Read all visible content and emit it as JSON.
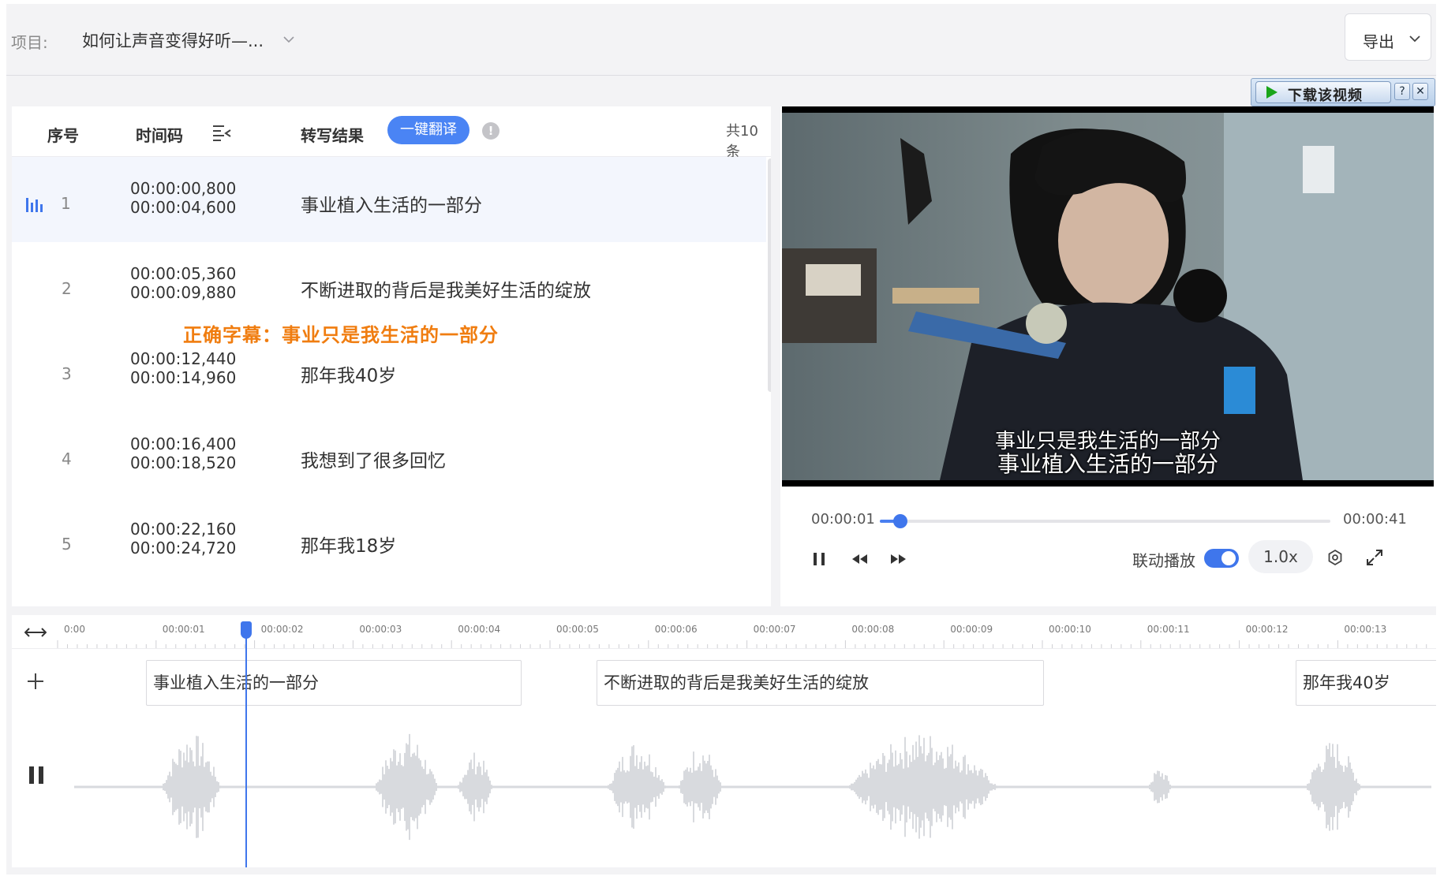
{
  "header": {
    "project_label": "项目:",
    "project_name": "如何让声音变得好听—...",
    "export_label": "导出"
  },
  "download_bar": {
    "label": "下载该视频",
    "help": "?",
    "close": "✕"
  },
  "list": {
    "columns": {
      "index": "序号",
      "timecode": "时间码",
      "result": "转写结果"
    },
    "translate_button": "一键翻译",
    "info": "!",
    "count": "共10条",
    "rows": [
      {
        "index": "1",
        "start": "00:00:00,800",
        "end": "00:00:04,600",
        "text": "事业植入生活的一部分"
      },
      {
        "index": "2",
        "start": "00:00:05,360",
        "end": "00:00:09,880",
        "text": "不断进取的背后是我美好生活的绽放"
      },
      {
        "index": "3",
        "start": "00:00:12,440",
        "end": "00:00:14,960",
        "text": "那年我40岁"
      },
      {
        "index": "4",
        "start": "00:00:16,400",
        "end": "00:00:18,520",
        "text": "我想到了很多回忆"
      },
      {
        "index": "5",
        "start": "00:00:22,160",
        "end": "00:00:24,720",
        "text": "那年我18岁"
      }
    ],
    "correct_note": "正确字幕：事业只是我生活的一部分"
  },
  "player": {
    "subtitle_overlay": "事业只是我生活的一部分",
    "subtitle_main": "事业植入生活的一部分",
    "current_time": "00:00:01",
    "total_time": "00:00:41",
    "progress": 0.045,
    "link_play_label": "联动播放",
    "link_play_on": true,
    "speed": "1.0x"
  },
  "timeline": {
    "ticks": [
      "0:00",
      "00:00:01",
      "00:00:02",
      "00:00:03",
      "00:00:04",
      "00:00:05",
      "00:00:06",
      "00:00:07",
      "00:00:08",
      "00:00:09",
      "00:00:10",
      "00:00:11",
      "00:00:12",
      "00:00:13"
    ],
    "segments": [
      {
        "text": "事业植入生活的一部分"
      },
      {
        "text": "不断进取的背后是我美好生活的绽放"
      },
      {
        "text": "那年我40岁"
      }
    ]
  },
  "colors": {
    "accent": "#3f76ec",
    "highlight_note": "#f07d10",
    "waveform": "#cfd0d6"
  }
}
